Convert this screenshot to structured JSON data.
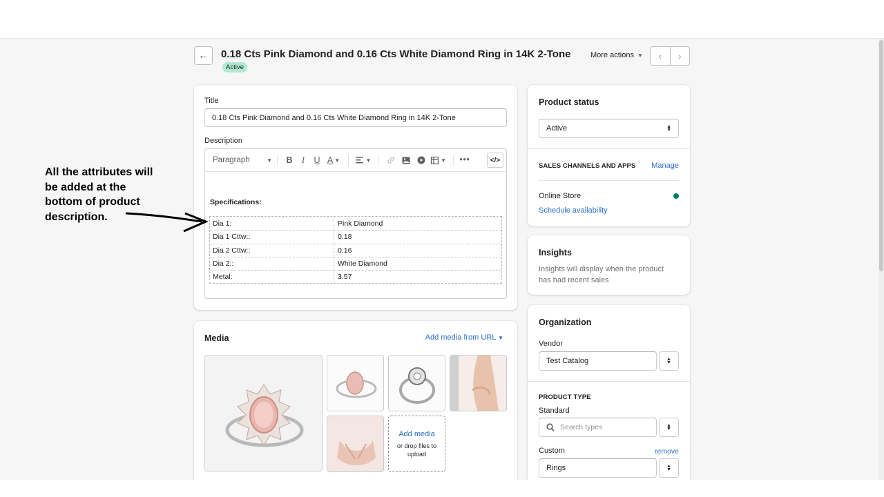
{
  "header": {
    "title": "0.18 Cts Pink Diamond and 0.16 Cts White Diamond Ring in 14K 2-Tone",
    "status_badge": "Active",
    "more_actions": "More actions"
  },
  "product": {
    "title_label": "Title",
    "title_value": "0.18 Cts Pink Diamond and 0.16 Cts White Diamond Ring in 14K 2-Tone",
    "description_label": "Description",
    "paragraph_select": "Paragraph",
    "specifications_heading": "Specifications:",
    "specs": [
      {
        "key": "Dia 1:",
        "value": "Pink Diamond"
      },
      {
        "key": "Dia 1 Cttw::",
        "value": "0.18"
      },
      {
        "key": "Dia 2 Cttw::",
        "value": "0.16"
      },
      {
        "key": "Dia 2::",
        "value": "White Diamond"
      },
      {
        "key": "Metal:",
        "value": "3.57"
      }
    ]
  },
  "annotation": {
    "text": "All the attributes will be added at the bottom of product description."
  },
  "media": {
    "title": "Media",
    "add_from_url": "Add media from URL",
    "add_media": "Add media",
    "drop_hint": "or drop files to upload"
  },
  "status_card": {
    "title": "Product status",
    "status_value": "Active",
    "channels_heading": "SALES CHANNELS AND APPS",
    "manage": "Manage",
    "online_store": "Online Store",
    "schedule": "Schedule availability"
  },
  "insights": {
    "title": "Insights",
    "text": "Insights will display when the product has had recent sales"
  },
  "organization": {
    "title": "Organization",
    "vendor_label": "Vendor",
    "vendor_value": "Test Catalog",
    "product_type_heading": "PRODUCT TYPE",
    "standard_label": "Standard",
    "search_placeholder": "Search types",
    "custom_label": "Custom",
    "remove": "remove",
    "custom_value": "Rings"
  },
  "colors": {
    "accent": "#2c6ecb",
    "active_badge": "#aee9d1",
    "online_dot": "#007f5f"
  }
}
